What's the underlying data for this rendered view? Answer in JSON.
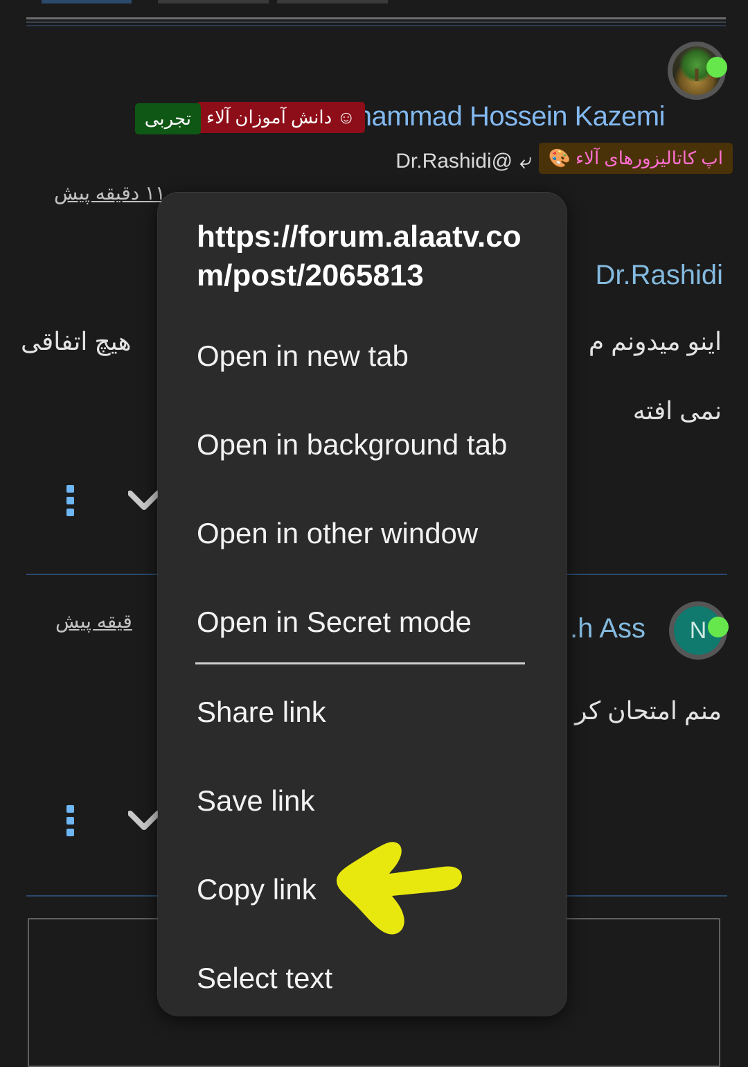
{
  "app": {
    "theme": "dark",
    "background_color": "#1b1b1b",
    "menu_background_color": "#2b2b2b",
    "accent_color": "#83b9f0",
    "annotation_color": "#e8e80f"
  },
  "post_1": {
    "author_name": "Mohammad Hossein Kazemi",
    "avatar_icon": "bonsai-tree-avatar",
    "online_status_icon": "online-dot",
    "badges": [
      {
        "label": "تجربی",
        "color": "#0f5714",
        "text_color": "#ffffff"
      },
      {
        "label": "☺ دانش آموزان آلاء",
        "color": "#8d0d18",
        "text_color": "#ffffff"
      },
      {
        "label": "اپ کاتالیزورهای آلاء",
        "icon": "palette-icon",
        "color": "#4a3208",
        "text_color": "#ff6fd0"
      }
    ],
    "reply_to": "Dr.Rashidi@",
    "reply_icon": "reply-arrow-icon",
    "timestamp": "۱۱ دقیقه پیش",
    "quoted_user": "Dr.Rashidi",
    "body_right_1": "اینو میدونم م",
    "body_left_1": "هیچ اتفاقی",
    "body_right_2": "نمی افته",
    "overflow_icon": "kebab-menu-icon",
    "expand_icon": "chevron-down-icon"
  },
  "post_2": {
    "author_name": ".h Ass",
    "avatar_initial": "N",
    "avatar_color": "#0f7a6d",
    "online_status_icon": "online-dot",
    "timestamp": "قیقه پیش",
    "body_right_1": "منم امتحان کر",
    "overflow_icon": "kebab-menu-icon",
    "expand_icon": "chevron-down-icon"
  },
  "context_menu": {
    "url": "https://forum.alaatv.com/post/2065813",
    "items": [
      {
        "label": "Open in new tab"
      },
      {
        "label": "Open in background tab"
      },
      {
        "label": "Open in other window"
      },
      {
        "label": "Open in Secret mode"
      },
      {
        "label": "Share link"
      },
      {
        "label": "Save link"
      },
      {
        "label": "Copy link",
        "highlighted": true
      },
      {
        "label": "Select text"
      }
    ],
    "divider_after_index": 3
  },
  "annotation": {
    "type": "arrow",
    "points_to": "Copy link",
    "color": "#e8e80f",
    "direction": "left"
  },
  "composer": {
    "placeholder": ""
  }
}
